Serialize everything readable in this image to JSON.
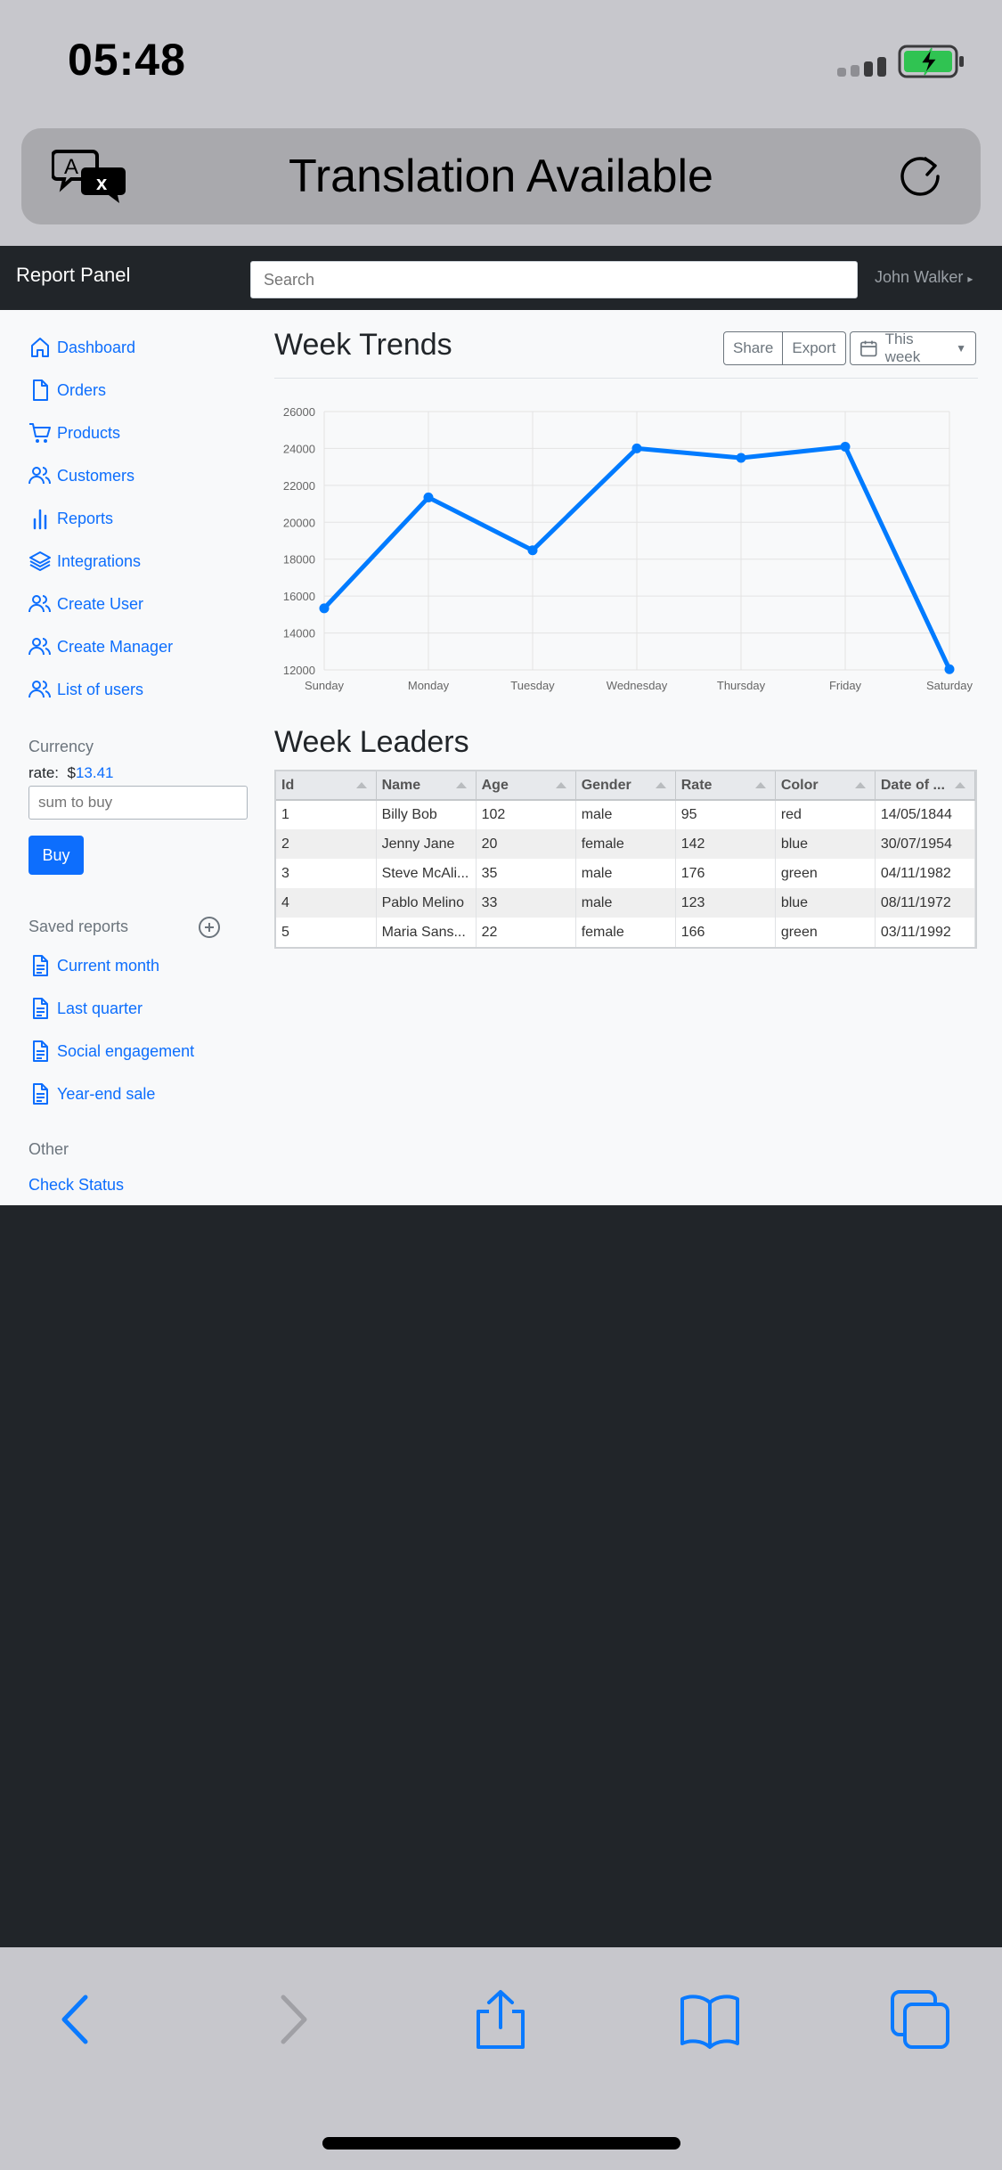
{
  "status_bar": {
    "time": "05:48"
  },
  "translation_bar": {
    "title": "Translation Available"
  },
  "navbar": {
    "brand": "Report Panel",
    "search_placeholder": "Search",
    "user": "John Walker"
  },
  "sidebar": {
    "items": [
      {
        "label": "Dashboard",
        "icon": "home-icon"
      },
      {
        "label": "Orders",
        "icon": "file-icon"
      },
      {
        "label": "Products",
        "icon": "cart-icon"
      },
      {
        "label": "Customers",
        "icon": "users-icon"
      },
      {
        "label": "Reports",
        "icon": "bar-chart-icon"
      },
      {
        "label": "Integrations",
        "icon": "layers-icon"
      },
      {
        "label": "Create User",
        "icon": "users-icon"
      },
      {
        "label": "Create Manager",
        "icon": "users-icon"
      },
      {
        "label": "List of users",
        "icon": "users-icon"
      }
    ],
    "currency": {
      "heading": "Currency",
      "rate_label": "rate:",
      "rate_symbol": "$",
      "rate_value": "13.41",
      "input_placeholder": "sum to buy",
      "buy_label": "Buy"
    },
    "saved_reports": {
      "heading": "Saved reports",
      "items": [
        "Current month",
        "Last quarter",
        "Social engagement",
        "Year-end sale"
      ]
    },
    "other": {
      "heading": "Other",
      "check_status": "Check Status"
    }
  },
  "main": {
    "trends_title": "Week Trends",
    "share_label": "Share",
    "export_label": "Export",
    "period_label": "This week",
    "leaders_title": "Week Leaders"
  },
  "chart_data": {
    "type": "line",
    "categories": [
      "Sunday",
      "Monday",
      "Tuesday",
      "Wednesday",
      "Thursday",
      "Friday",
      "Saturday"
    ],
    "series": [
      {
        "values": [
          15339,
          21345,
          18483,
          24003,
          23489,
          24092,
          12034
        ]
      }
    ],
    "ylim": [
      12000,
      26000
    ],
    "yticks": [
      12000,
      14000,
      16000,
      18000,
      20000,
      22000,
      24000,
      26000
    ],
    "grid": true,
    "color": "#007bff"
  },
  "table": {
    "columns": [
      "Id",
      "Name",
      "Age",
      "Gender",
      "Rate",
      "Color",
      "Date of ..."
    ],
    "rows": [
      [
        "1",
        "Billy Bob",
        "102",
        "male",
        "95",
        "red",
        "14/05/1844"
      ],
      [
        "2",
        "Jenny Jane",
        "20",
        "female",
        "142",
        "blue",
        "30/07/1954"
      ],
      [
        "3",
        "Steve McAli...",
        "35",
        "male",
        "176",
        "green",
        "04/11/1982"
      ],
      [
        "4",
        "Pablo Melino",
        "33",
        "male",
        "123",
        "blue",
        "08/11/1972"
      ],
      [
        "5",
        "Maria Sans...",
        "22",
        "female",
        "166",
        "green",
        "03/11/1992"
      ]
    ]
  },
  "colors": {
    "accent": "#0d6efd",
    "navbar": "#212529",
    "ios_blue": "#0a7aff"
  }
}
